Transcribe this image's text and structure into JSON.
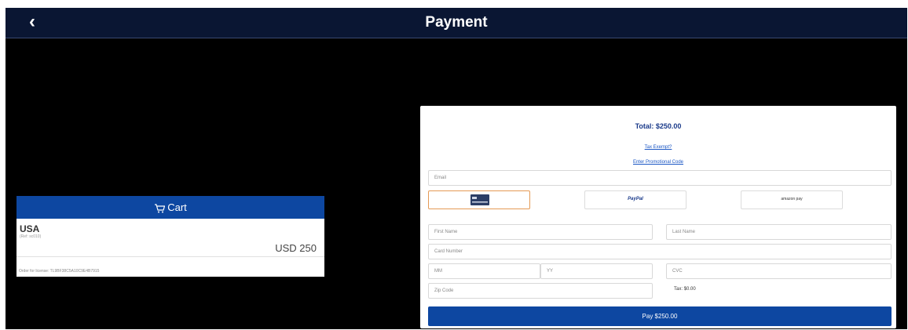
{
  "header": {
    "back_glyph": "‹",
    "title": "Payment"
  },
  "cart": {
    "heading": "Cart",
    "item": {
      "country": "USA",
      "ref": "(Ref: sc010)",
      "price": "USD 250"
    },
    "footer": "Order for license: TL9BF38C5A10C9E4B7915"
  },
  "payment": {
    "total": "Total: $250.00",
    "tax_exempt_link": "Tax Exempt?",
    "promo_link": "Enter Promotional Code",
    "fields": {
      "email": "Email",
      "first_name": "First Name",
      "last_name": "Last Name",
      "card_number": "Card Number",
      "mm": "MM",
      "yy": "YY",
      "cvc": "CVC",
      "zip": "Zip Code"
    },
    "methods": {
      "card_icon": "credit-card-icon",
      "paypal_label": "PayPal",
      "amazon_label": "amazon pay"
    },
    "tax": "Tax: $0.00",
    "pay_button": "Pay $250.00"
  },
  "colors": {
    "topbar": "#0a1633",
    "accent_blue": "#0d47a1",
    "active_method_border": "#e59a55"
  }
}
